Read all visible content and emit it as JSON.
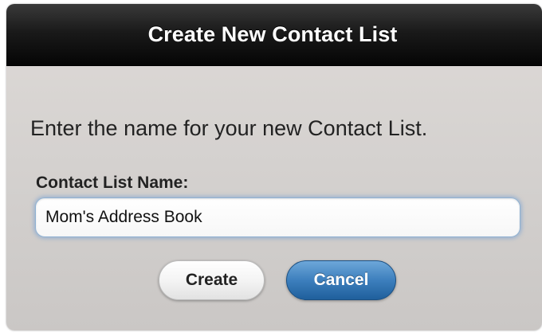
{
  "dialog": {
    "title": "Create New Contact List",
    "prompt": "Enter the name for your new Contact List.",
    "field_label": "Contact List Name:",
    "field_value": "Mom's Address Book"
  },
  "buttons": {
    "create_label": "Create",
    "cancel_label": "Cancel"
  },
  "colors": {
    "title_bar": "#111111",
    "accent_button": "#3d7fbd",
    "focus_ring": "#8fb1d2"
  }
}
